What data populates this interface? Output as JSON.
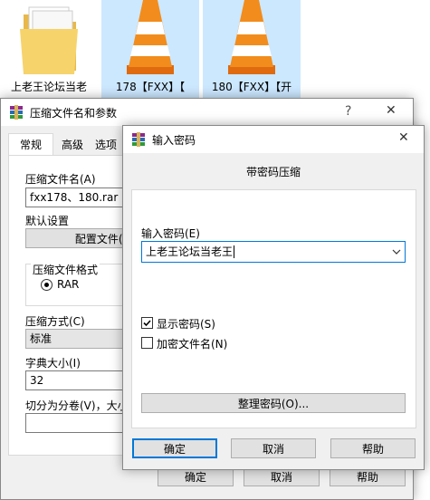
{
  "desktop": {
    "files": [
      {
        "label": "上老王论坛当老"
      },
      {
        "label": "178【FXX】【"
      },
      {
        "label": "180【FXX】【开"
      }
    ]
  },
  "main_dialog": {
    "title": "压缩文件名和参数",
    "help_label": "?",
    "close_label": "✕",
    "tabs": [
      "常规",
      "高级",
      "选项"
    ],
    "archive_name_label": "压缩文件名(A)",
    "archive_name_value": "fxx178、180.rar",
    "default_settings_label": "默认设置",
    "profiles_button": "配置文件(F)",
    "format_group_label": "压缩文件格式",
    "format_rar_label": "RAR",
    "compression_method_label": "压缩方式(C)",
    "compression_method_value": "标准",
    "dictionary_label": "字典大小(I)",
    "dictionary_value": "32",
    "split_label": "切分为分卷(V)，大小",
    "ok_label": "确定",
    "cancel_label": "取消",
    "help_button_label": "帮助"
  },
  "password_dialog": {
    "title": "输入密码",
    "close_label": "✕",
    "heading": "带密码压缩",
    "password_label": "输入密码(E)",
    "password_value": "上老王论坛当老王",
    "show_password_label": "显示密码(S)",
    "show_password_checked": true,
    "encrypt_names_label": "加密文件名(N)",
    "encrypt_names_checked": false,
    "organize_button": "整理密码(O)...",
    "ok_label": "确定",
    "cancel_label": "取消",
    "help_label": "帮助"
  }
}
